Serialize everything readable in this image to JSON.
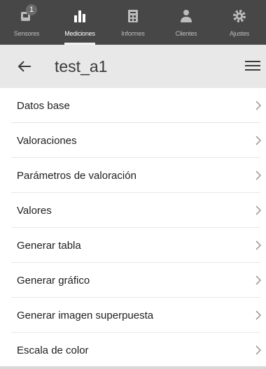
{
  "tabs": [
    {
      "label": "Sensores",
      "icon": "sensor-icon",
      "badge": "1"
    },
    {
      "label": "Mediciones",
      "icon": "bar-chart-icon",
      "active": true
    },
    {
      "label": "Informes",
      "icon": "report-icon"
    },
    {
      "label": "Clientes",
      "icon": "clients-icon"
    },
    {
      "label": "Ajustes",
      "icon": "gear-icon"
    }
  ],
  "header": {
    "title": "test_a1"
  },
  "menu_items": [
    {
      "label": "Datos base"
    },
    {
      "label": "Valoraciones"
    },
    {
      "label": "Parámetros de valoración"
    },
    {
      "label": "Valores"
    },
    {
      "label": "Generar tabla"
    },
    {
      "label": "Generar gráfico"
    },
    {
      "label": "Generar imagen superpuesta"
    },
    {
      "label": "Escala de color"
    }
  ],
  "colors": {
    "tabbar": "#474747",
    "header": "#e8e8e8",
    "text": "#1e1e1e"
  }
}
